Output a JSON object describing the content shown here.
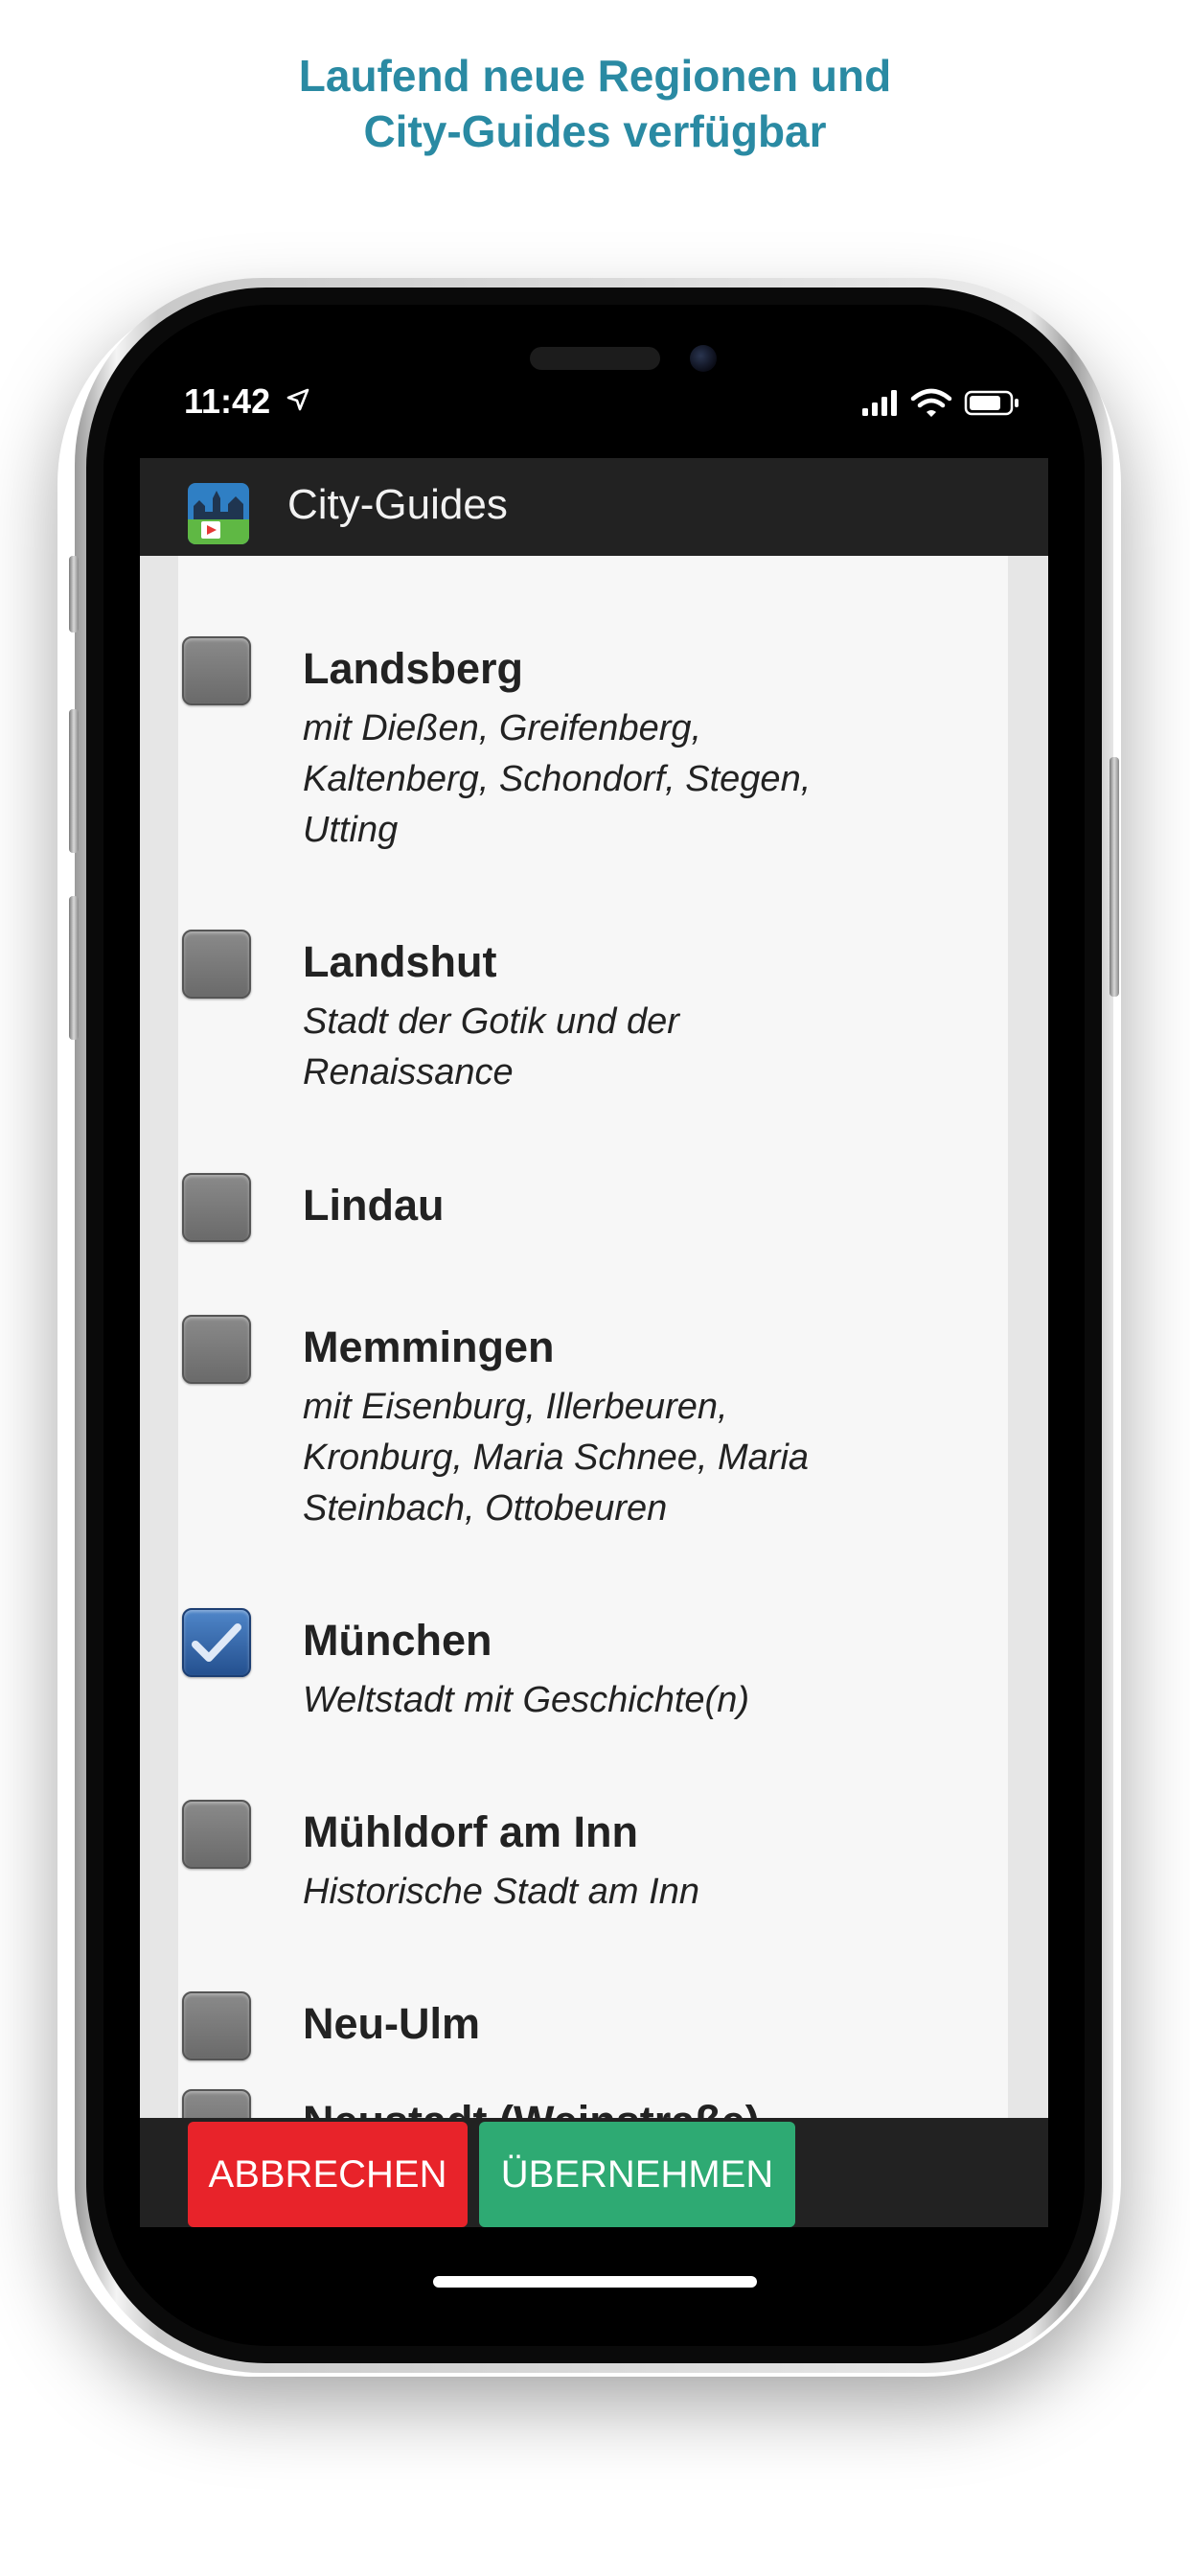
{
  "promo": {
    "line1": "Laufend neue Regionen und",
    "line2": "City-Guides verfügbar"
  },
  "status_bar": {
    "time": "11:42",
    "icons": [
      "location-arrow-icon",
      "cellular-signal-icon",
      "wifi-icon",
      "battery-icon"
    ]
  },
  "app_bar": {
    "title": "City-Guides",
    "logo_icon": "city-guides-app-icon"
  },
  "list": {
    "items": [
      {
        "title": "Landsberg",
        "subtitle": "mit Dießen, Greifenberg, Kaltenberg, Schondorf, Stegen, Utting",
        "checked": false
      },
      {
        "title": "Landshut",
        "subtitle": "Stadt der Gotik und der Renaissance",
        "checked": false
      },
      {
        "title": "Lindau",
        "subtitle": "",
        "checked": false
      },
      {
        "title": "Memmingen",
        "subtitle": "mit Eisenburg, Illerbeuren, Kronburg, Maria Schnee, Maria Steinbach, Ottobeuren",
        "checked": false
      },
      {
        "title": "München",
        "subtitle": "Weltstadt mit Geschichte(n)",
        "checked": true
      },
      {
        "title": "Mühldorf am Inn",
        "subtitle": "Historische Stadt am Inn",
        "checked": false
      },
      {
        "title": "Neu-Ulm",
        "subtitle": "",
        "checked": false
      },
      {
        "title": "Neustadt (Weinstraße)",
        "subtitle": "",
        "checked": false
      }
    ]
  },
  "actions": {
    "cancel_label": "ABBRECHEN",
    "apply_label": "ÜBERNEHMEN"
  },
  "colors": {
    "headline": "#2a8aa3",
    "app_bar": "#222222",
    "cancel": "#e8232a",
    "apply": "#2eaa73",
    "checked": "#3a6fb2"
  }
}
